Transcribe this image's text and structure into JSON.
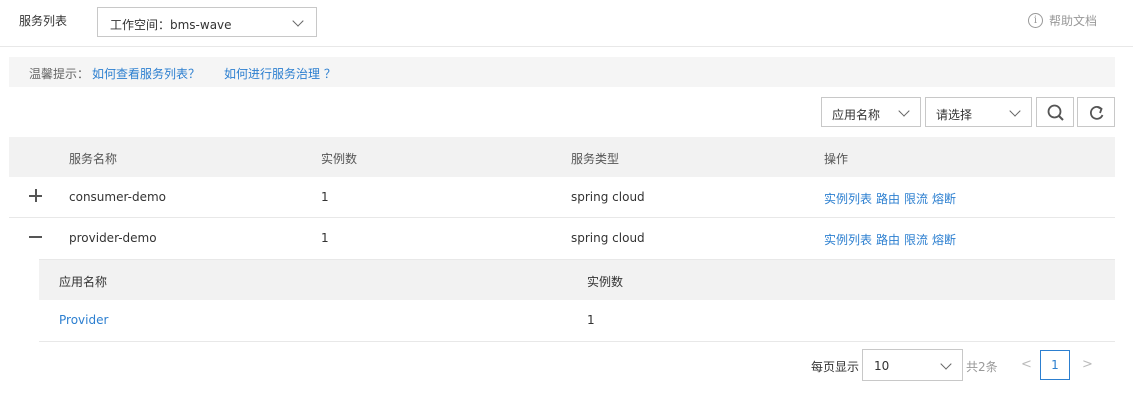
{
  "header": {
    "title": "服务列表",
    "workspace": "工作空间：bms-wave",
    "help": "帮助文档"
  },
  "tip": {
    "label": "温馨提示：",
    "link1": "如何查看服务列表？",
    "link2": "如何进行服务治理 ？"
  },
  "filters": {
    "field": "应用名称",
    "value": "请选择"
  },
  "table": {
    "columns": [
      "服务名称",
      "实例数",
      "服务类型",
      "操作"
    ],
    "rows": [
      {
        "expander": "+",
        "name": "consumer-demo",
        "instances": "1",
        "type": "spring cloud",
        "ops": [
          "实例列表",
          "路由",
          "限流",
          "熔断"
        ]
      },
      {
        "expander": "−",
        "name": "provider-demo",
        "instances": "1",
        "type": "spring cloud",
        "ops": [
          "实例列表",
          "路由",
          "限流",
          "熔断"
        ]
      }
    ],
    "sub": {
      "columns": [
        "应用名称",
        "实例数"
      ],
      "rows": [
        {
          "app": "Provider",
          "instances": "1"
        }
      ]
    }
  },
  "pager": {
    "per_page_label": "每页显示",
    "per_page": "10",
    "total": "共2条",
    "prev": "<",
    "next": ">",
    "current": "1"
  },
  "icons": [
    "info-icon",
    "chevron-down-icon",
    "search-icon",
    "refresh-icon",
    "plus-icon",
    "minus-icon"
  ],
  "colors": {
    "link": "#2c7fd0",
    "header_bg": "#f2f2f2",
    "tip_bg": "#f5f5f5"
  }
}
